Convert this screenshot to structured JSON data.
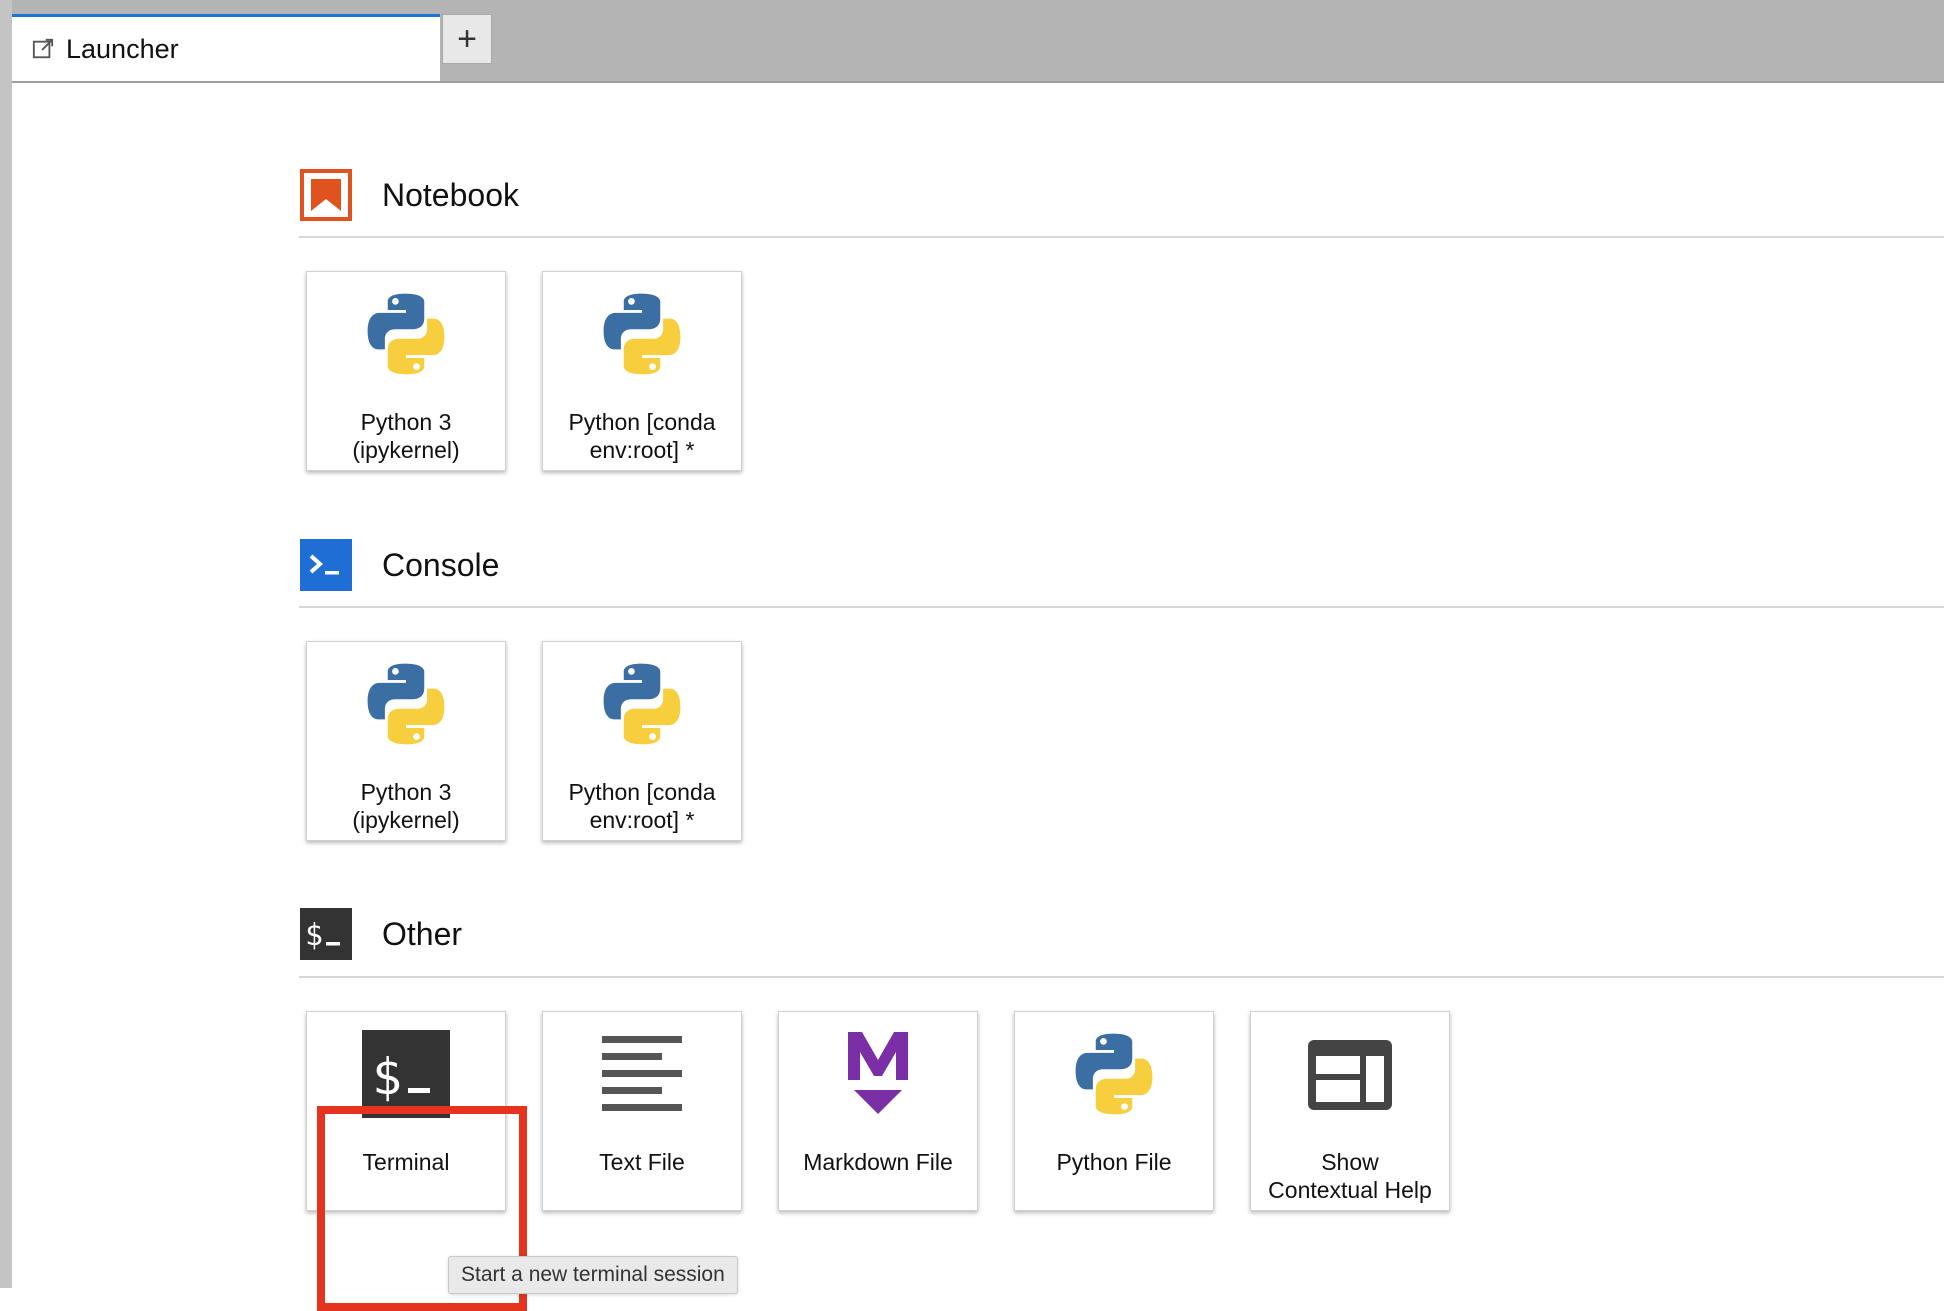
{
  "tabs": {
    "active_label": "Launcher",
    "add_tab_label": "+"
  },
  "sections": {
    "notebook": {
      "title": "Notebook",
      "cards": [
        {
          "label_line1": "Python 3",
          "label_line2": "(ipykernel)",
          "icon": "python-icon"
        },
        {
          "label_line1": "Python [conda",
          "label_line2": "env:root] *",
          "icon": "python-icon"
        }
      ]
    },
    "console": {
      "title": "Console",
      "cards": [
        {
          "label_line1": "Python 3",
          "label_line2": "(ipykernel)",
          "icon": "python-icon"
        },
        {
          "label_line1": "Python [conda",
          "label_line2": "env:root] *",
          "icon": "python-icon"
        }
      ]
    },
    "other": {
      "title": "Other",
      "cards": [
        {
          "label_line1": "Terminal",
          "label_line2": "",
          "icon": "terminal-icon"
        },
        {
          "label_line1": "Text File",
          "label_line2": "",
          "icon": "text-file-icon"
        },
        {
          "label_line1": "Markdown File",
          "label_line2": "",
          "icon": "markdown-icon"
        },
        {
          "label_line1": "Python File",
          "label_line2": "",
          "icon": "python-icon"
        },
        {
          "label_line1": "Show",
          "label_line2": "Contextual Help",
          "icon": "contextual-help-icon"
        }
      ]
    }
  },
  "tooltip": {
    "text": "Start a new terminal session"
  },
  "colors": {
    "tab_accent": "#1976d2",
    "notebook_icon": "#e0531f",
    "console_icon": "#1f6ed6",
    "other_icon": "#333333",
    "markdown_icon": "#7b2fa6",
    "highlight": "#e63320",
    "python_blue": "#3b6fa3",
    "python_yellow": "#f7cf3e"
  }
}
